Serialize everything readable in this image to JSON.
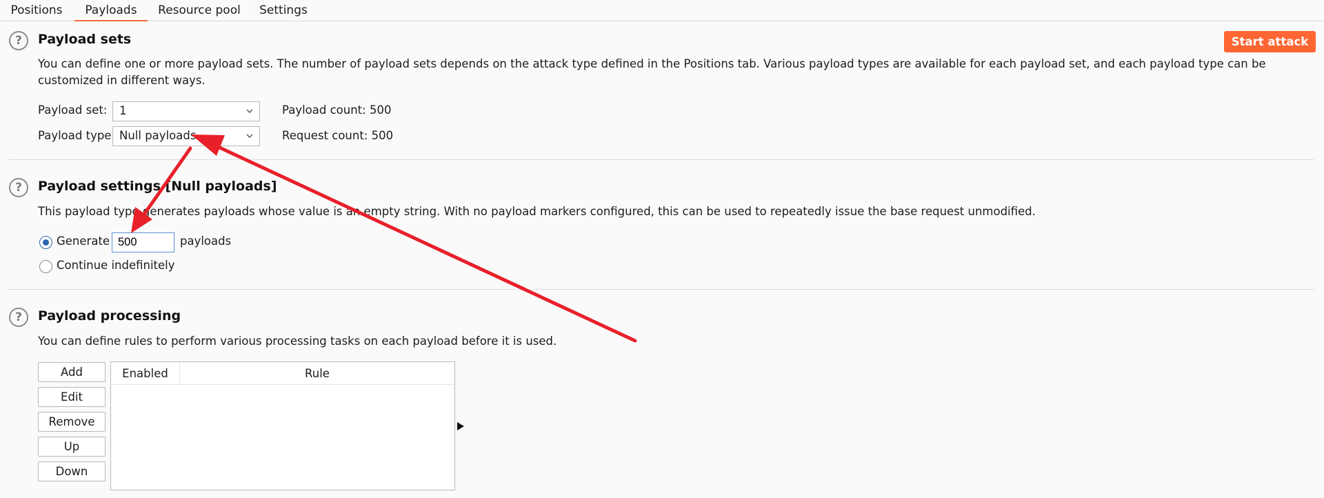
{
  "tabs": [
    {
      "label": "Positions"
    },
    {
      "label": "Payloads"
    },
    {
      "label": "Resource pool"
    },
    {
      "label": "Settings"
    }
  ],
  "payload_sets": {
    "title": "Payload sets",
    "description": "You can define one or more payload sets. The number of payload sets depends on the attack type defined in the Positions tab. Various payload types are available for each payload set, and each payload type can be customized in different ways.",
    "start_attack_label": "Start attack",
    "payload_set_label": "Payload set:",
    "payload_set_value": "1",
    "payload_type_label": "Payload type:",
    "payload_type_value": "Null payloads",
    "payload_count_label": "Payload count:",
    "payload_count_value": "500",
    "request_count_label": "Request count:",
    "request_count_value": "500"
  },
  "payload_settings": {
    "title": "Payload settings [Null payloads]",
    "description": "This payload type generates payloads whose value is an empty string. With no payload markers configured, this can be used to repeatedly issue the base request unmodified.",
    "generate_label": "Generate",
    "generate_value": "500",
    "payloads_suffix": "payloads",
    "continue_label": "Continue indefinitely",
    "selected_option": "generate"
  },
  "payload_processing": {
    "title": "Payload processing",
    "description": "You can define rules to perform various processing tasks on each payload before it is used.",
    "buttons": {
      "add": "Add",
      "edit": "Edit",
      "remove": "Remove",
      "up": "Up",
      "down": "Down"
    },
    "columns": {
      "enabled": "Enabled",
      "rule": "Rule"
    }
  },
  "colors": {
    "accent": "#ff6633",
    "radio_selected": "#2a64b0",
    "annotation_arrow": "#e8202a"
  },
  "icons": {
    "help": "question-circle-icon",
    "dropdown": "chevron-down-icon",
    "expand": "play-arrow-icon"
  }
}
